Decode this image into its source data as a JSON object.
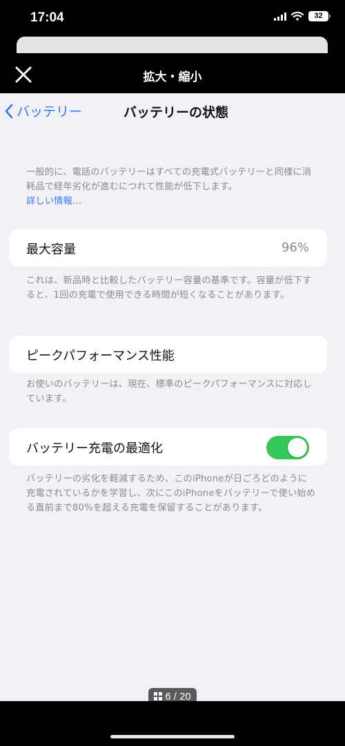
{
  "status_bar": {
    "time": "17:04",
    "battery_level": "32",
    "icons": [
      "cellular-signal-icon",
      "wifi-icon",
      "battery-icon"
    ]
  },
  "viewer": {
    "title": "拡大・縮小",
    "close_icon": "close-icon",
    "page_indicator": "6 / 20",
    "page_indicator_icon": "grid-icon"
  },
  "settings": {
    "back_label": "バッテリー",
    "title": "バッテリーの状態",
    "intro_text": "一般的に、電話のバッテリーはすべての充電式バッテリーと同様に消耗品で経年劣化が進むにつれて性能が低下します。",
    "intro_link": "詳しい情報...",
    "max_capacity": {
      "label": "最大容量",
      "value": "96%",
      "footnote": "これは、新品時と比較したバッテリー容量の基準です。容量が低下すると、1回の充電で使用できる時間が短くなることがあります。"
    },
    "peak_performance": {
      "label": "ピークパフォーマンス性能",
      "footnote": "お使いのバッテリーは、現在、標準のピークパフォーマンスに対応しています。"
    },
    "optimized_charging": {
      "label": "バッテリー充電の最適化",
      "enabled": true,
      "footnote": "バッテリーの劣化を軽減するため、このiPhoneが日ごろどのように充電されているかを学習し、次にこのiPhoneをバッテリーで使い始める直前まで80%を超える充電を保留することがあります。"
    }
  },
  "colors": {
    "accent": "#3478f6",
    "toggle_on": "#34c759",
    "background": "#f2f1f6",
    "secondary_text": "#8a8a8e"
  }
}
